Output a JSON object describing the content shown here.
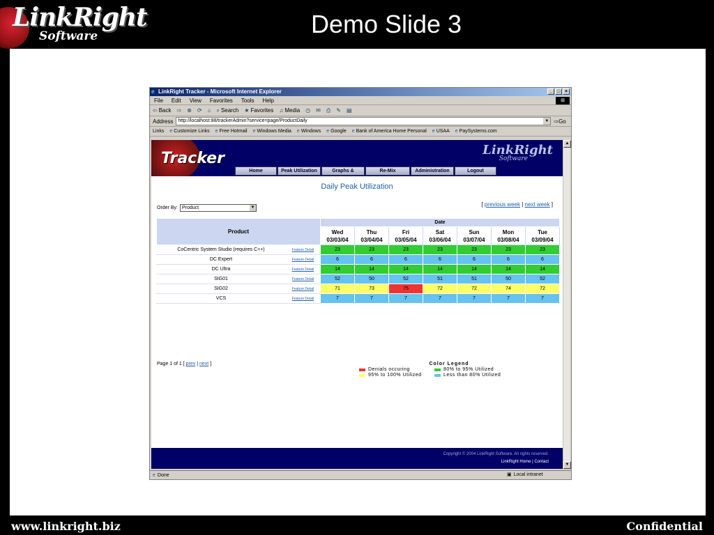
{
  "slide": {
    "logo_text": "LinkRight",
    "logo_sub": "Software",
    "title": "Demo Slide 3",
    "footer_left": "www.linkright.biz",
    "footer_right": "Confidential"
  },
  "browser": {
    "window_title": "LinkRight Tracker - Microsoft Internet Explorer",
    "menu": [
      "File",
      "Edit",
      "View",
      "Favorites",
      "Tools",
      "Help"
    ],
    "toolbar": [
      "Back",
      "Search",
      "Favorites",
      "Media"
    ],
    "address_label": "Address",
    "address_value": "http://localhost:88/trackerAdmin?service=page/ProductDaily",
    "go_label": "Go",
    "links_label": "Links",
    "links": [
      "Customize Links",
      "Free Hotmail",
      "Windows Media",
      "Windows",
      "Google",
      "Bank of America Home Personal",
      "USAA",
      "PaySystems.com"
    ],
    "status_text": "Done",
    "status_zone": "Local intranet"
  },
  "app": {
    "header_title": "Tracker",
    "logo_text": "LinkRight",
    "logo_sub": "Software",
    "nav": [
      "Home",
      "Peak Utilization",
      "Graphs & Charts",
      "Re-Mix Calculator",
      "Administration",
      "Logout"
    ],
    "page_title": "Daily Peak Utilization",
    "order_by_label": "Order By:",
    "order_by_value": "Product",
    "prev_week": "previous week",
    "next_week": "next week",
    "table": {
      "product_header": "Product",
      "date_header": "Date",
      "days": [
        {
          "day": "Wed",
          "date": "03/03/04"
        },
        {
          "day": "Thu",
          "date": "03/04/04"
        },
        {
          "day": "Fri",
          "date": "03/05/04"
        },
        {
          "day": "Sat",
          "date": "03/06/04"
        },
        {
          "day": "Sun",
          "date": "03/07/04"
        },
        {
          "day": "Mon",
          "date": "03/08/04"
        },
        {
          "day": "Tue",
          "date": "03/09/04"
        }
      ],
      "link_label": "Feature Detail",
      "rows": [
        {
          "name": "CoCentric System Studio (requires C++)",
          "values": [
            "23",
            "23",
            "23",
            "23",
            "23",
            "23",
            "23"
          ],
          "colors": [
            "green",
            "green",
            "green",
            "green",
            "green",
            "green",
            "green"
          ]
        },
        {
          "name": "DC Expert",
          "values": [
            "6",
            "6",
            "6",
            "6",
            "6",
            "6",
            "6"
          ],
          "colors": [
            "blue",
            "blue",
            "blue",
            "blue",
            "blue",
            "blue",
            "blue"
          ]
        },
        {
          "name": "DC Ultra",
          "values": [
            "14",
            "14",
            "14",
            "14",
            "14",
            "14",
            "14"
          ],
          "colors": [
            "green",
            "green",
            "green",
            "green",
            "green",
            "green",
            "green"
          ]
        },
        {
          "name": "SIG01",
          "values": [
            "52",
            "50",
            "52",
            "51",
            "51",
            "50",
            "52"
          ],
          "colors": [
            "blue",
            "blue",
            "blue",
            "blue",
            "blue",
            "blue",
            "blue"
          ]
        },
        {
          "name": "SIG02",
          "values": [
            "71",
            "73",
            "75",
            "72",
            "72",
            "74",
            "72"
          ],
          "colors": [
            "yellow",
            "yellow",
            "red",
            "yellow",
            "yellow",
            "yellow",
            "yellow"
          ]
        },
        {
          "name": "VCS",
          "values": [
            "7",
            "7",
            "7",
            "7",
            "7",
            "7",
            "7"
          ],
          "colors": [
            "blue",
            "blue",
            "blue",
            "blue",
            "blue",
            "blue",
            "blue"
          ]
        }
      ]
    },
    "pager": {
      "text": "Page 1 of 1 [",
      "prev": "prev",
      "sep": "|",
      "next": "next",
      "end": "]"
    },
    "legend": {
      "title": "Color Legend",
      "items": [
        {
          "label": "Denials occuring",
          "color": "#ee3333"
        },
        {
          "label": "80% to 95% Utilized",
          "color": "#33cc33"
        },
        {
          "label": "95% to 100% Utilized",
          "color": "#ffff66"
        },
        {
          "label": "Less than 80% Utilized",
          "color": "#66c2ee"
        }
      ]
    },
    "copyright": "Copyright © 2004 LinkRight Software. All rights reserved.",
    "footer_home": "LinkRight Home",
    "footer_contact": "Contact"
  }
}
